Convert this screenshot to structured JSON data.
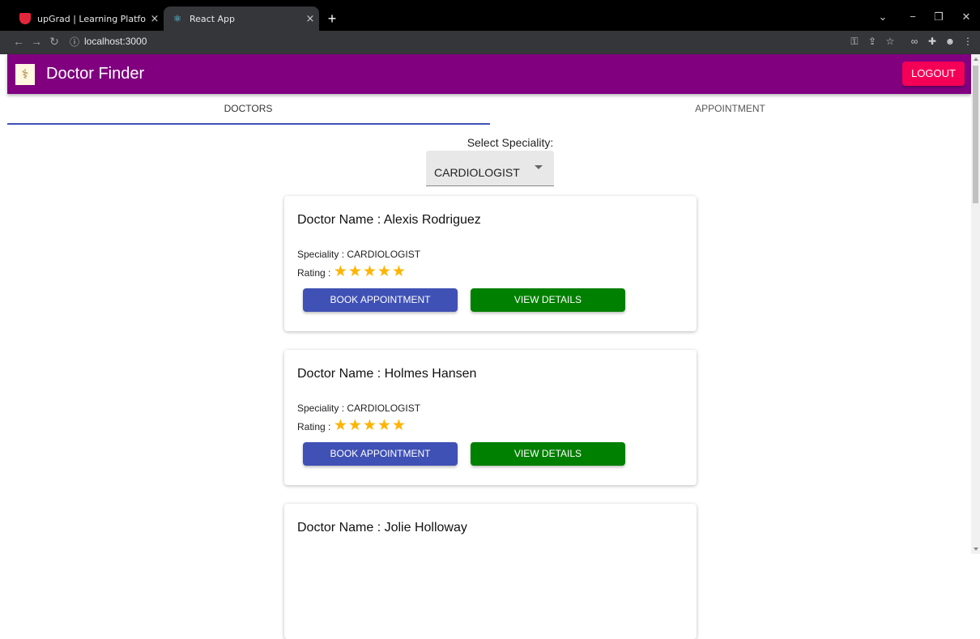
{
  "browser": {
    "tabs": [
      {
        "title": "upGrad | Learning Platform",
        "close": "×"
      },
      {
        "title": "React App",
        "close": "×"
      }
    ],
    "new_tab": "+",
    "url": "localhost:3000",
    "window_controls": [
      "⌄",
      "−",
      "❐",
      "✕"
    ]
  },
  "app": {
    "title": "Doctor Finder",
    "logout_label": "LOGOUT",
    "logo_icon": "caduceus-icon"
  },
  "tabs": [
    {
      "label": "DOCTORS",
      "selected": true
    },
    {
      "label": "APPOINTMENT",
      "selected": false
    }
  ],
  "speciality_select": {
    "label": "Select Speciality:",
    "value": "CARDIOLOGIST"
  },
  "doctors": [
    {
      "name": "Doctor Name : Alexis Rodriguez",
      "speciality": "Speciality : CARDIOLOGIST",
      "rating_label": "Rating :",
      "rating": 5,
      "book_label": "BOOK APPOINTMENT",
      "view_label": "VIEW DETAILS"
    },
    {
      "name": "Doctor Name : Holmes Hansen",
      "speciality": "Speciality : CARDIOLOGIST",
      "rating_label": "Rating :",
      "rating": 5,
      "book_label": "BOOK APPOINTMENT",
      "view_label": "VIEW DETAILS"
    },
    {
      "name": "Doctor Name : Jolie Holloway"
    }
  ],
  "colors": {
    "appbar": "#800080",
    "logout": "#f50057",
    "book_button": "#3f51b5",
    "view_button": "#008000",
    "star": "#ffb400",
    "tab_indicator": "#3f51b5"
  }
}
